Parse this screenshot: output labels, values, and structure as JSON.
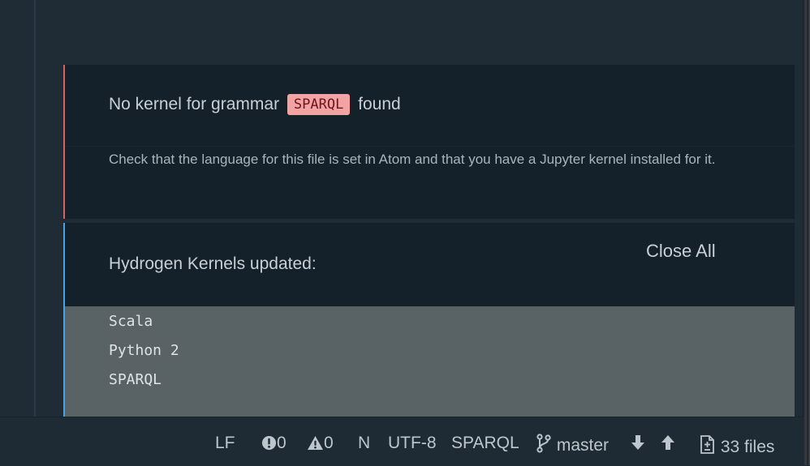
{
  "notifications": {
    "error": {
      "title_prefix": "No kernel for grammar",
      "grammar": "SPARQL",
      "title_suffix": "found",
      "description": "Check that the language for this file is set in Atom and that you have a Jupyter kernel installed for it."
    },
    "info": {
      "title": "Hydrogen Kernels updated:",
      "close_all_label": "Close All",
      "kernels": [
        "Scala",
        "Python 2",
        "SPARQL"
      ]
    }
  },
  "status_bar": {
    "line_ending": "LF",
    "error_count": "0",
    "warning_count": "0",
    "n_label": "N",
    "encoding": "UTF-8",
    "grammar": "SPARQL",
    "branch": "master",
    "files": "33 files"
  },
  "colors": {
    "error_accent": "#d5645d",
    "info_accent": "#4aa3e0",
    "badge_bg": "#f2a3a3"
  }
}
